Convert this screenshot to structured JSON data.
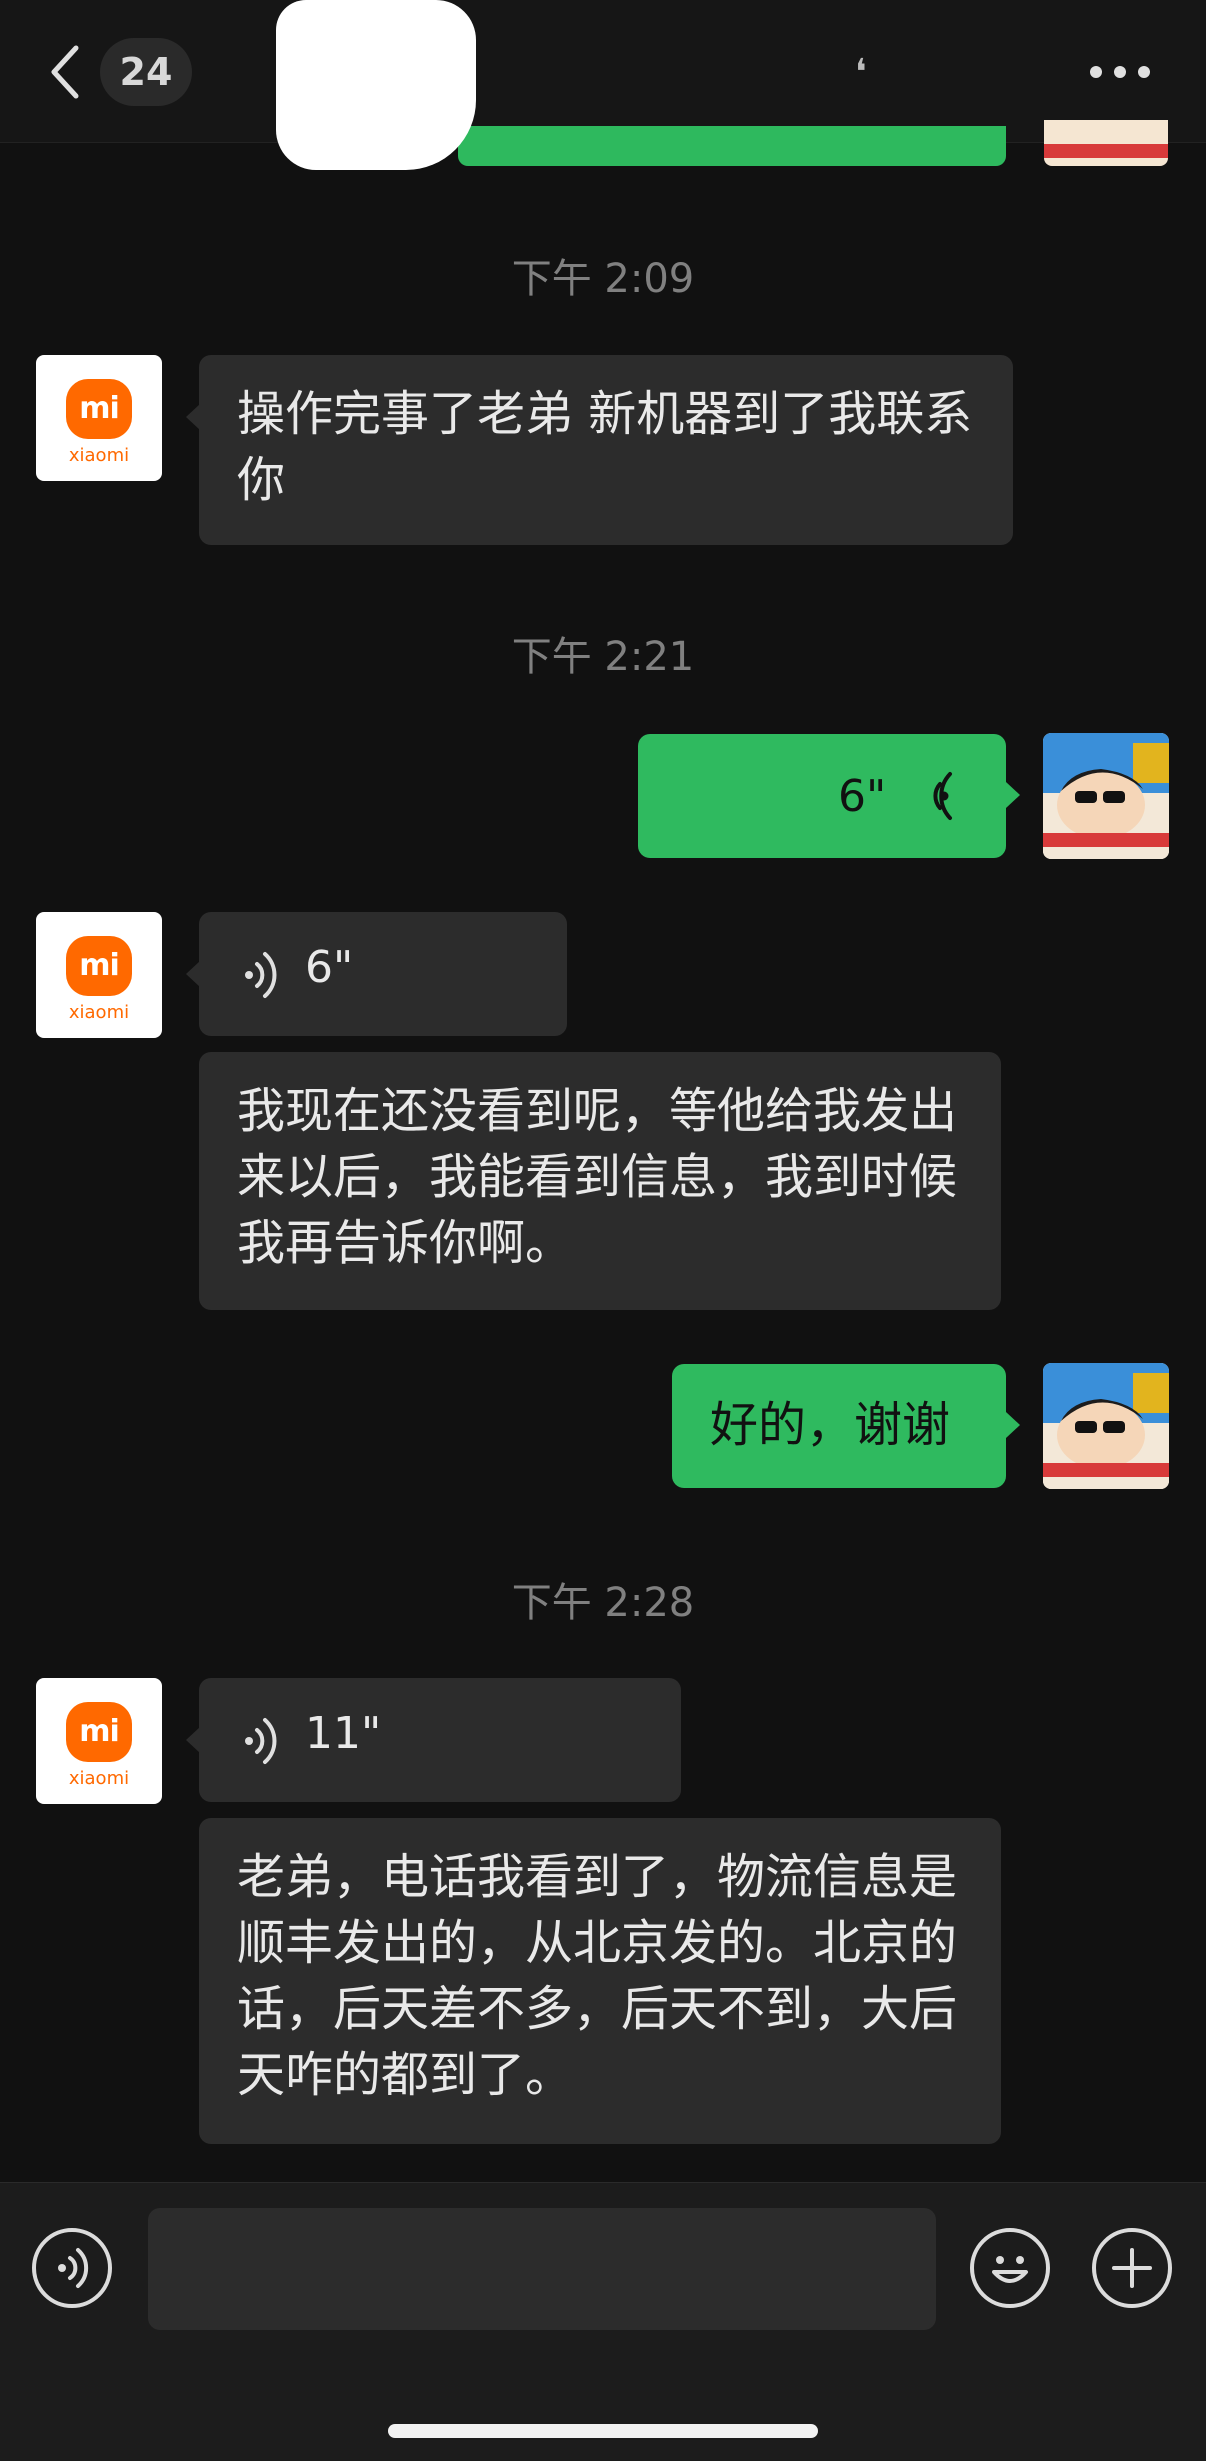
{
  "header": {
    "unread_count": "24",
    "title_fragment": "\""
  },
  "messages": [
    {
      "time": "下午 2:09"
    },
    {
      "from": "them",
      "type": "text",
      "text": "操作完事了老弟 新机器到了我联系你"
    },
    {
      "time": "下午 2:21"
    },
    {
      "from": "me",
      "type": "voice",
      "duration": "6\""
    },
    {
      "from": "them",
      "type": "voice",
      "duration": "6\""
    },
    {
      "from": "them",
      "type": "text",
      "text": "我现在还没看到呢，等他给我发出来以后，我能看到信息，我到时候我再告诉你啊。"
    },
    {
      "from": "me",
      "type": "text",
      "text": "好的，谢谢"
    },
    {
      "time": "下午 2:28"
    },
    {
      "from": "them",
      "type": "voice",
      "duration": "11\""
    },
    {
      "from": "them",
      "type": "text",
      "text": "老弟，电话我看到了，物流信息是顺丰发出的，从北京发的。北京的话，后天差不多，后天不到，大后天咋的都到了。"
    }
  ],
  "avatar_them": {
    "logo_text": "mi",
    "brand": "xiaomi",
    "brand_color": "#ff6900"
  },
  "colors": {
    "background": "#111111",
    "bubble_in": "#2c2c2c",
    "bubble_out": "#2fba5f",
    "timestamp": "#808080"
  },
  "icons": [
    "back-chevron-icon",
    "more-dots-icon",
    "voice-wave-icon",
    "voice-toggle-icon",
    "emoji-icon",
    "plus-icon"
  ]
}
